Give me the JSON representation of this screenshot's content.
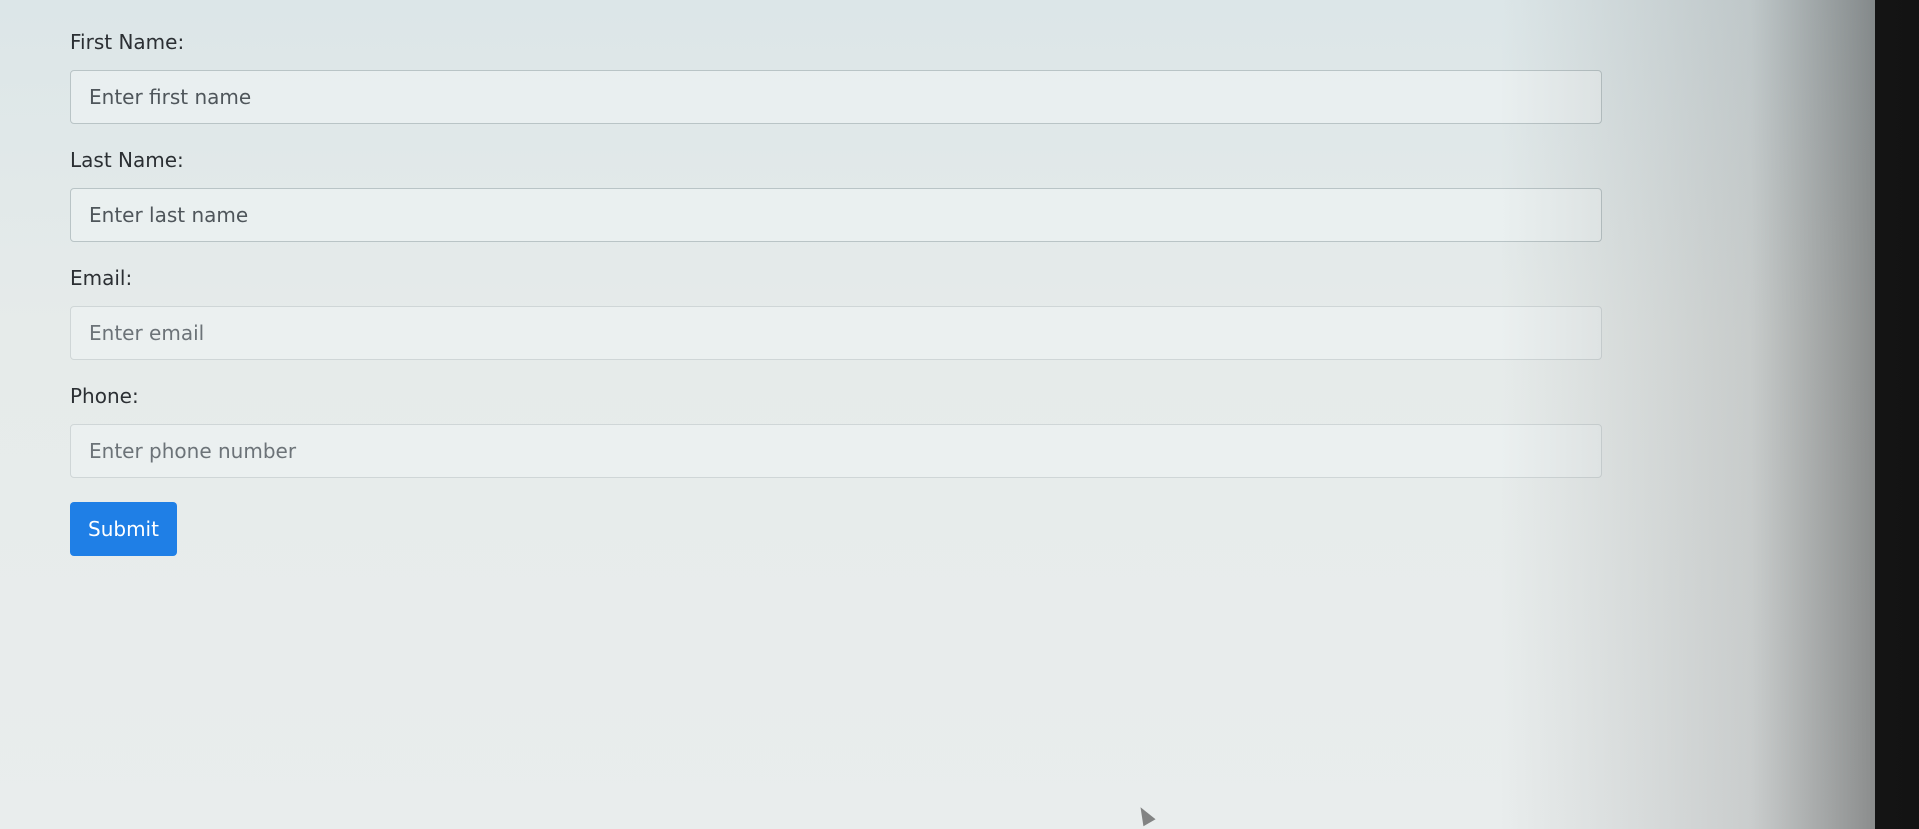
{
  "form": {
    "first_name": {
      "label": "First Name:",
      "placeholder": "Enter first name"
    },
    "last_name": {
      "label": "Last Name:",
      "placeholder": "Enter last name"
    },
    "email": {
      "label": "Email:",
      "placeholder": "Enter email"
    },
    "phone": {
      "label": "Phone:",
      "placeholder": "Enter phone number"
    },
    "submit_label": "Submit"
  },
  "colors": {
    "primary_button": "#1f7fe6",
    "label_text": "#2b2f33"
  }
}
